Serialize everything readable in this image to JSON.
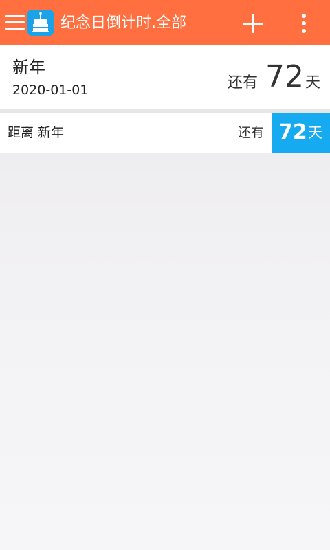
{
  "colors": {
    "appbar": "#ff6f40",
    "badge": "#16aaf0",
    "icon_tile": "#1aa3e8"
  },
  "appbar": {
    "title": "纪念日倒计时.全部",
    "menu_icon": "hamburger-menu-icon",
    "app_icon": "birthday-cake-icon",
    "add_icon": "plus-icon",
    "more_icon": "more-vert-icon"
  },
  "header_card": {
    "title": "新年",
    "date": "2020-01-01",
    "remain_label": "还有",
    "days": "72",
    "unit": "天"
  },
  "events": [
    {
      "title": "距离 新年",
      "remain_label": "还有",
      "days": "72",
      "unit": "天"
    }
  ]
}
